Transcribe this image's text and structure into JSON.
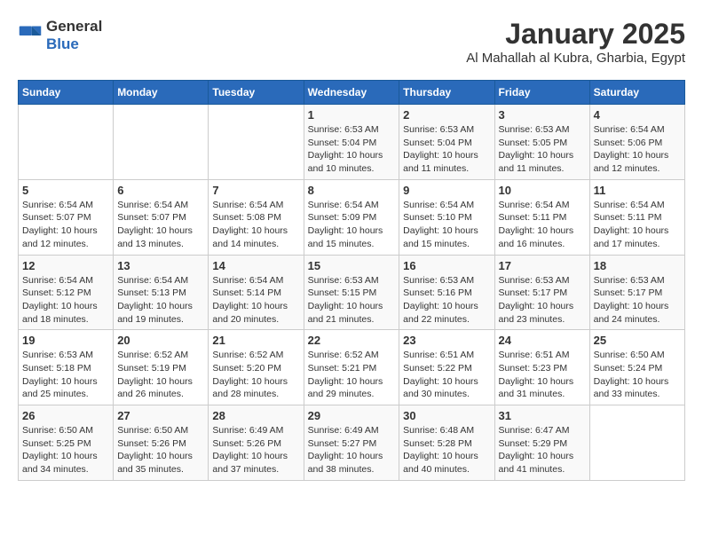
{
  "header": {
    "logo": {
      "general": "General",
      "blue": "Blue"
    },
    "title": "January 2025",
    "subtitle": "Al Mahallah al Kubra, Gharbia, Egypt"
  },
  "calendar": {
    "weekdays": [
      "Sunday",
      "Monday",
      "Tuesday",
      "Wednesday",
      "Thursday",
      "Friday",
      "Saturday"
    ],
    "weeks": [
      [
        {
          "day": "",
          "info": ""
        },
        {
          "day": "",
          "info": ""
        },
        {
          "day": "",
          "info": ""
        },
        {
          "day": "1",
          "info": "Sunrise: 6:53 AM\nSunset: 5:04 PM\nDaylight: 10 hours and 10 minutes."
        },
        {
          "day": "2",
          "info": "Sunrise: 6:53 AM\nSunset: 5:04 PM\nDaylight: 10 hours and 11 minutes."
        },
        {
          "day": "3",
          "info": "Sunrise: 6:53 AM\nSunset: 5:05 PM\nDaylight: 10 hours and 11 minutes."
        },
        {
          "day": "4",
          "info": "Sunrise: 6:54 AM\nSunset: 5:06 PM\nDaylight: 10 hours and 12 minutes."
        }
      ],
      [
        {
          "day": "5",
          "info": "Sunrise: 6:54 AM\nSunset: 5:07 PM\nDaylight: 10 hours and 12 minutes."
        },
        {
          "day": "6",
          "info": "Sunrise: 6:54 AM\nSunset: 5:07 PM\nDaylight: 10 hours and 13 minutes."
        },
        {
          "day": "7",
          "info": "Sunrise: 6:54 AM\nSunset: 5:08 PM\nDaylight: 10 hours and 14 minutes."
        },
        {
          "day": "8",
          "info": "Sunrise: 6:54 AM\nSunset: 5:09 PM\nDaylight: 10 hours and 15 minutes."
        },
        {
          "day": "9",
          "info": "Sunrise: 6:54 AM\nSunset: 5:10 PM\nDaylight: 10 hours and 15 minutes."
        },
        {
          "day": "10",
          "info": "Sunrise: 6:54 AM\nSunset: 5:11 PM\nDaylight: 10 hours and 16 minutes."
        },
        {
          "day": "11",
          "info": "Sunrise: 6:54 AM\nSunset: 5:11 PM\nDaylight: 10 hours and 17 minutes."
        }
      ],
      [
        {
          "day": "12",
          "info": "Sunrise: 6:54 AM\nSunset: 5:12 PM\nDaylight: 10 hours and 18 minutes."
        },
        {
          "day": "13",
          "info": "Sunrise: 6:54 AM\nSunset: 5:13 PM\nDaylight: 10 hours and 19 minutes."
        },
        {
          "day": "14",
          "info": "Sunrise: 6:54 AM\nSunset: 5:14 PM\nDaylight: 10 hours and 20 minutes."
        },
        {
          "day": "15",
          "info": "Sunrise: 6:53 AM\nSunset: 5:15 PM\nDaylight: 10 hours and 21 minutes."
        },
        {
          "day": "16",
          "info": "Sunrise: 6:53 AM\nSunset: 5:16 PM\nDaylight: 10 hours and 22 minutes."
        },
        {
          "day": "17",
          "info": "Sunrise: 6:53 AM\nSunset: 5:17 PM\nDaylight: 10 hours and 23 minutes."
        },
        {
          "day": "18",
          "info": "Sunrise: 6:53 AM\nSunset: 5:17 PM\nDaylight: 10 hours and 24 minutes."
        }
      ],
      [
        {
          "day": "19",
          "info": "Sunrise: 6:53 AM\nSunset: 5:18 PM\nDaylight: 10 hours and 25 minutes."
        },
        {
          "day": "20",
          "info": "Sunrise: 6:52 AM\nSunset: 5:19 PM\nDaylight: 10 hours and 26 minutes."
        },
        {
          "day": "21",
          "info": "Sunrise: 6:52 AM\nSunset: 5:20 PM\nDaylight: 10 hours and 28 minutes."
        },
        {
          "day": "22",
          "info": "Sunrise: 6:52 AM\nSunset: 5:21 PM\nDaylight: 10 hours and 29 minutes."
        },
        {
          "day": "23",
          "info": "Sunrise: 6:51 AM\nSunset: 5:22 PM\nDaylight: 10 hours and 30 minutes."
        },
        {
          "day": "24",
          "info": "Sunrise: 6:51 AM\nSunset: 5:23 PM\nDaylight: 10 hours and 31 minutes."
        },
        {
          "day": "25",
          "info": "Sunrise: 6:50 AM\nSunset: 5:24 PM\nDaylight: 10 hours and 33 minutes."
        }
      ],
      [
        {
          "day": "26",
          "info": "Sunrise: 6:50 AM\nSunset: 5:25 PM\nDaylight: 10 hours and 34 minutes."
        },
        {
          "day": "27",
          "info": "Sunrise: 6:50 AM\nSunset: 5:26 PM\nDaylight: 10 hours and 35 minutes."
        },
        {
          "day": "28",
          "info": "Sunrise: 6:49 AM\nSunset: 5:26 PM\nDaylight: 10 hours and 37 minutes."
        },
        {
          "day": "29",
          "info": "Sunrise: 6:49 AM\nSunset: 5:27 PM\nDaylight: 10 hours and 38 minutes."
        },
        {
          "day": "30",
          "info": "Sunrise: 6:48 AM\nSunset: 5:28 PM\nDaylight: 10 hours and 40 minutes."
        },
        {
          "day": "31",
          "info": "Sunrise: 6:47 AM\nSunset: 5:29 PM\nDaylight: 10 hours and 41 minutes."
        },
        {
          "day": "",
          "info": ""
        }
      ]
    ]
  }
}
